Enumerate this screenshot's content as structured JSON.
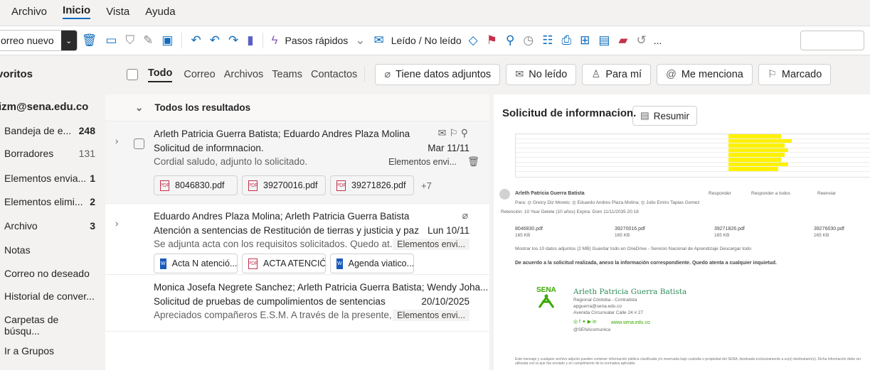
{
  "menu": [
    "Archivo",
    "Inicio",
    "Vista",
    "Ayuda"
  ],
  "ribbon": {
    "new_mail": "orreo nuevo",
    "quick_steps": "Pasos rápidos",
    "read_unread": "Leído / No leído",
    "more": "..."
  },
  "sidebar": {
    "favorites": "voritos",
    "account": "izm@sena.edu.co",
    "folders": [
      {
        "label": "Bandeja de e...",
        "count": "248"
      },
      {
        "label": "Borradores",
        "count": "131"
      },
      {
        "label": "Elementos envia...",
        "count": "1"
      },
      {
        "label": "Elementos elimi...",
        "count": "2"
      },
      {
        "label": "Archivo",
        "count": "3"
      },
      {
        "label": "Notas",
        "count": ""
      },
      {
        "label": "Correo no deseado",
        "count": ""
      },
      {
        "label": "Historial de conver...",
        "count": ""
      },
      {
        "label": "Carpetas de búsqu...",
        "count": ""
      },
      {
        "label": "Ir a Grupos",
        "count": ""
      }
    ]
  },
  "filters": {
    "tabs": [
      "Todo",
      "Correo",
      "Archivos",
      "Teams",
      "Contactos"
    ],
    "buttons": [
      "Tiene datos adjuntos",
      "No leído",
      "Para mí",
      "Me menciona",
      "Marcado"
    ]
  },
  "list": {
    "header": "Todos los resultados",
    "messages": [
      {
        "sender": "Arleth Patricia Guerra Batista; Eduardo Andres Plaza Molina",
        "subject": "Solicitud de informnacion.",
        "preview": "Cordial saludo, adjunto lo solicitado.",
        "date": "Mar 11/11",
        "folder": "Elementos envi...",
        "attachments": [
          "8046830.pdf",
          "39270016.pdf",
          "39271826.pdf"
        ],
        "more": "+7"
      },
      {
        "sender": "Eduardo Andres Plaza Molina; Arleth Patricia Guerra Batista",
        "subject": "Atención a sentencias de Restitución de tierras y justicia y paz",
        "preview": "Se adjunta acta con los requisitos solicitados. Quedo at...",
        "date": "Lun 10/11",
        "folder": "Elementos envi...",
        "attachments": [
          "Acta N atenció...",
          "ACTA ATENCIÓ...",
          "Agenda viatico..."
        ]
      },
      {
        "sender": "Monica Josefa Negrete Sanchez; Arleth Patricia Guerra Batista; Wendy Joha...",
        "subject": "Solicitud de pruebas de cumpolimientos de sentencias",
        "preview": "Apreciados compañeros E.S.M. A través de la presente, ...",
        "date": "20/10/2025",
        "folder": "Elementos envi..."
      }
    ]
  },
  "reading": {
    "title": "Solicitud de informnacion.",
    "summarize": "Resumir",
    "sender": "Arleth Patricia Guerra Batista",
    "to": "Para: ◎ Greicy Diz Morelo; ◎ Eduardo Andres Plaza Molina; ◎ Julio Emiro Tapias Gomez",
    "retention": "Retención: 10 Year Delete (10 años) Expira: Dom 11/11/2035 20:18",
    "reply": "Responder",
    "reply_all": "Responder a todos",
    "forward": "Reenviar",
    "attachments": [
      "8046830.pdf",
      "39270016.pdf",
      "39271826.pdf",
      "39276030.pdf"
    ],
    "att_size": "165 KB",
    "att_actions": "Mostrar los 10 datos adjuntos (2 MB)   Guardar todo en OneDrive - Servicio Nacional de Aprendizaje   Descargar todo",
    "body": "De acuerdo a la solicitud realizada, anexo la información correspondiente. Quedo atenta a cualquier inquietud.",
    "sig_name": "Arleth Patricia Guerra Batista",
    "sig_role": "Regional Córdoba - Contratista",
    "sig_email": "apguerra@sena.edu.co",
    "sig_addr": "Avenida Circunvalar Calle 24 # 27",
    "sig_web": "www.sena.edu.co",
    "sig_handle": "@SENAcomunica",
    "sena": "SENA",
    "disclaimer": "Este mensaje y cualquier archivo adjunto pueden contener información pública clasificada y/o reservada bajo custodia o propiedad del SENA, destinada exclusivamente a su(s) destinatario(s). Dicha información debe ser utilizada con la que fue enviado y en cumplimiento de la normativa aplicable."
  }
}
